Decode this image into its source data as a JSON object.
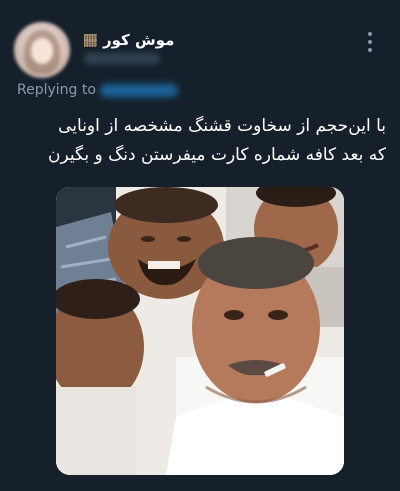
{
  "tweet": {
    "display_name": "موش کور",
    "name_emoji_icon": "mole-icon",
    "reply_label": "Replying to",
    "text_line1": "با این‌حجم از سخاوت قشنگ مشخصه از اونایی",
    "text_line2": "که بعد کافه شماره کارت میفرستن دنگ و بگیرن"
  },
  "media": {
    "subject": "selfie-photo"
  },
  "colors": {
    "background": "#15202b",
    "text_primary": "#ffffff",
    "text_secondary": "#8b98a5",
    "accent": "#1d9bf0"
  }
}
